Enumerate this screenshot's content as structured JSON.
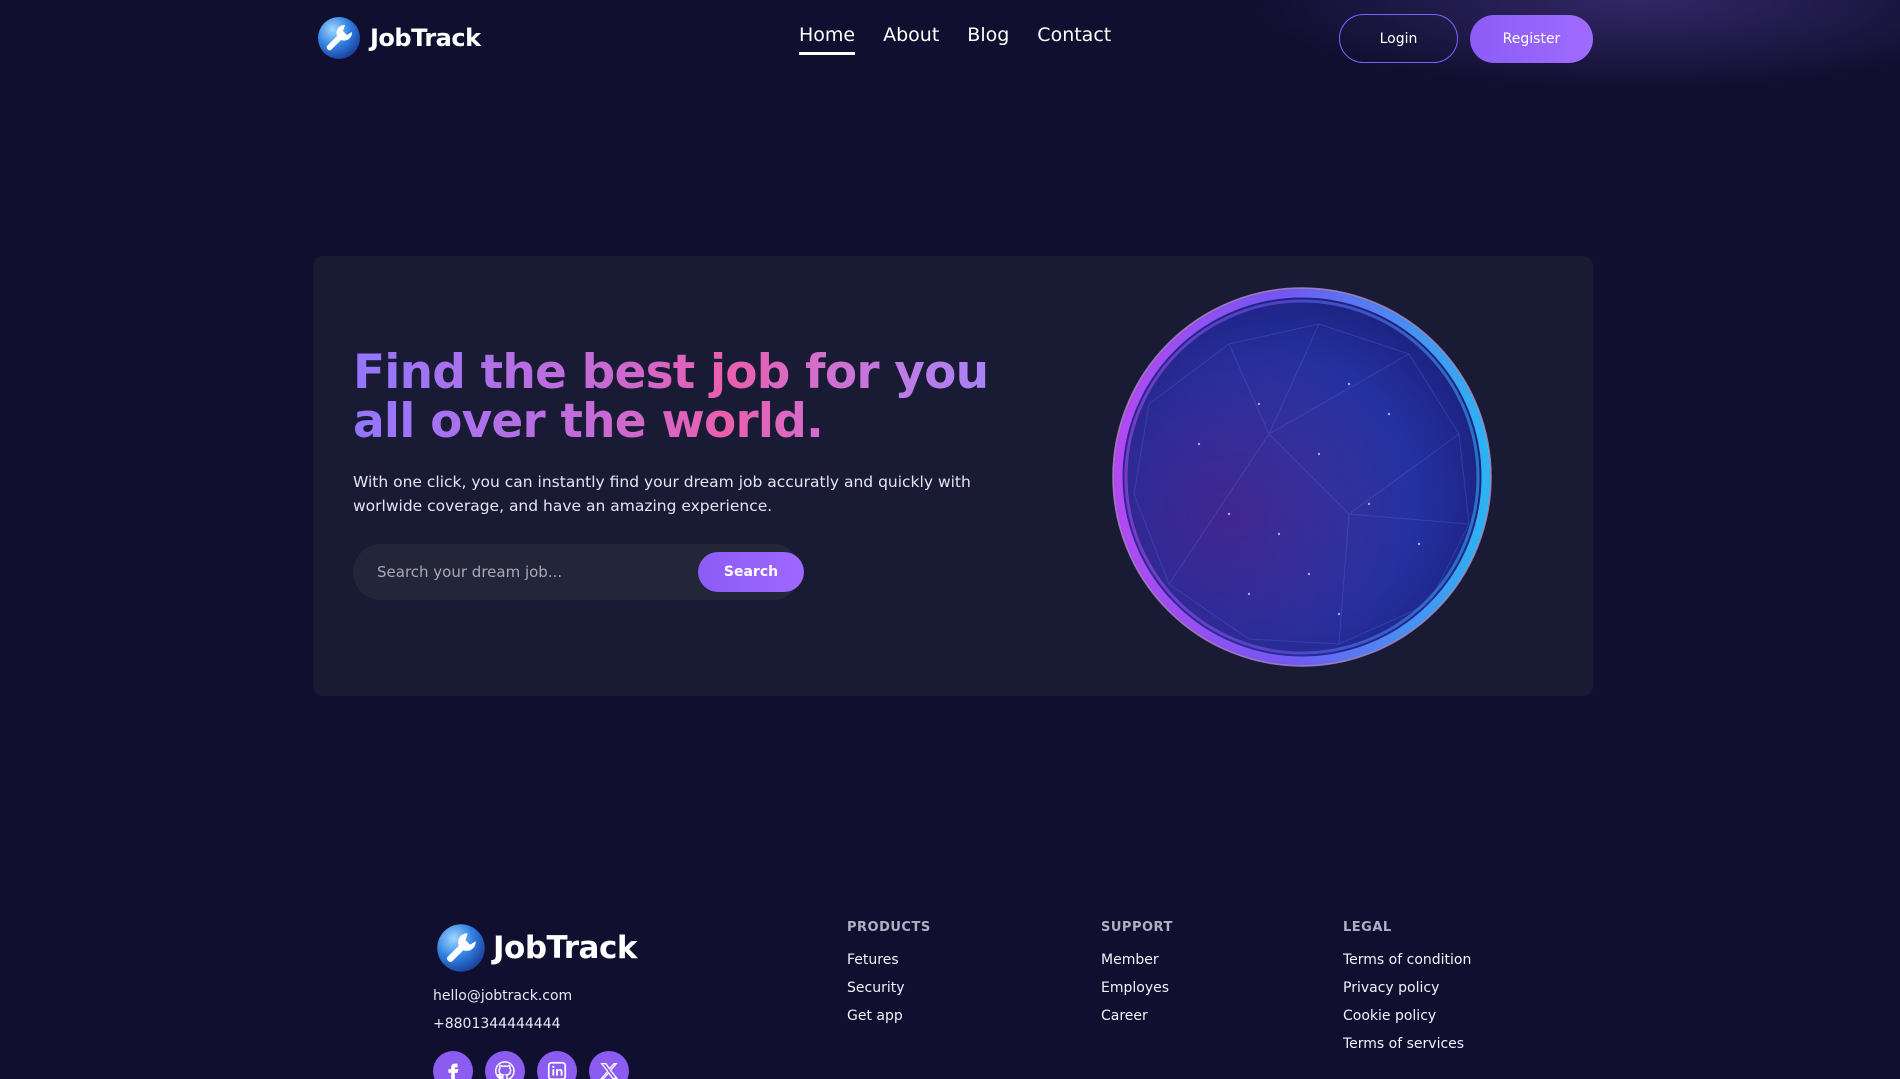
{
  "brand": {
    "name": "JobTrack",
    "icon": "wrench-globe-icon"
  },
  "nav": {
    "items": [
      {
        "label": "Home",
        "active": true
      },
      {
        "label": "About",
        "active": false
      },
      {
        "label": "Blog",
        "active": false
      },
      {
        "label": "Contact",
        "active": false
      }
    ]
  },
  "auth": {
    "login_label": "Login",
    "register_label": "Register"
  },
  "hero": {
    "title": "Find the best job for you all over the world.",
    "subtitle": "With one click, you can instantly find your dream job accuratly and quickly with worlwide coverage, and have an amazing experience.",
    "search": {
      "placeholder": "Search your dream job...",
      "value": "",
      "button_label": "Search"
    },
    "image_icon": "globe-sphere-icon"
  },
  "footer": {
    "email": "hello@jobtrack.com",
    "phone": "+8801344444444",
    "socials": [
      "facebook-icon",
      "github-icon",
      "linkedin-icon",
      "x-icon"
    ],
    "columns": [
      {
        "heading": "PRODUCTS",
        "links": [
          "Fetures",
          "Security",
          "Get app"
        ]
      },
      {
        "heading": "SUPPORT",
        "links": [
          "Member",
          "Employes",
          "Career"
        ]
      },
      {
        "heading": "LEGAL",
        "links": [
          "Terms of condition",
          "Privacy policy",
          "Cookie policy",
          "Terms of services"
        ]
      }
    ]
  },
  "colors": {
    "background": "#110f30",
    "card": "#191a33",
    "accent": "#8b5cf6",
    "title_gradient": [
      "#9277ff",
      "#ea5fae",
      "#9a86ff"
    ]
  }
}
